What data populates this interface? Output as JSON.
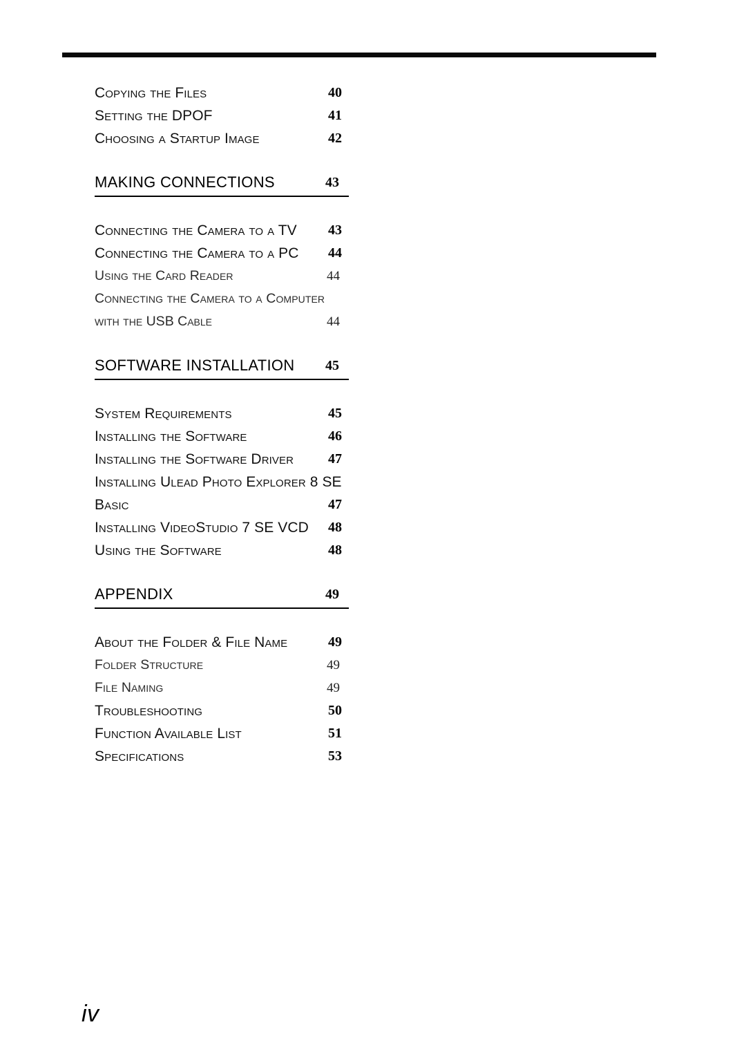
{
  "page": {
    "folio": "iv",
    "top_rule": true
  },
  "toc": {
    "blocks": [
      {
        "kind": "entries",
        "items": [
          {
            "type": "entry",
            "label": "Copying the Files",
            "page": "40"
          },
          {
            "type": "entry",
            "label": "Setting the DPOF",
            "page": "41"
          },
          {
            "type": "entry",
            "label": "Choosing a Startup Image",
            "page": "42"
          }
        ]
      },
      {
        "kind": "section",
        "heading": {
          "label": "MAKING CONNECTIONS",
          "page": "43"
        },
        "items": [
          {
            "type": "entry",
            "label": "Connecting the Camera to a TV",
            "page": "43"
          },
          {
            "type": "entry",
            "label": "Connecting the Camera to a PC",
            "page": "44"
          },
          {
            "type": "subentry",
            "label": "Using the Card Reader",
            "page": "44"
          },
          {
            "type": "subentry",
            "label": "Connecting the Camera to a Computer",
            "page": ""
          },
          {
            "type": "contline",
            "label": "with the USB Cable",
            "page": "44"
          }
        ]
      },
      {
        "kind": "section",
        "heading": {
          "label": "SOFTWARE INSTALLATION",
          "page": "45"
        },
        "items": [
          {
            "type": "entry",
            "label": "System Requirements",
            "page": "45"
          },
          {
            "type": "entry",
            "label": "Installing the Software",
            "page": "46"
          },
          {
            "type": "entry",
            "label": "Installing the Software Driver",
            "page": "47"
          },
          {
            "type": "entry",
            "label": "Installing Ulead Photo Explorer 8 SE",
            "page": ""
          },
          {
            "type": "entry",
            "label": "Basic",
            "page": "47"
          },
          {
            "type": "entry",
            "label": "Installing VideoStudio 7 SE VCD",
            "page": "48"
          },
          {
            "type": "entry",
            "label": "Using the Software",
            "page": "48"
          }
        ]
      },
      {
        "kind": "section",
        "heading": {
          "label": "APPENDIX",
          "page": "49"
        },
        "items": [
          {
            "type": "entry",
            "label": "About the Folder & File Name",
            "page": "49"
          },
          {
            "type": "subentry",
            "label": "Folder Structure",
            "page": "49"
          },
          {
            "type": "subentry",
            "label": "File Naming",
            "page": "49"
          },
          {
            "type": "entry",
            "label": "Troubleshooting",
            "page": "50"
          },
          {
            "type": "entry",
            "label": "Function Available List",
            "page": "51"
          },
          {
            "type": "entry",
            "label": "Specifications",
            "page": "53"
          }
        ]
      }
    ]
  }
}
